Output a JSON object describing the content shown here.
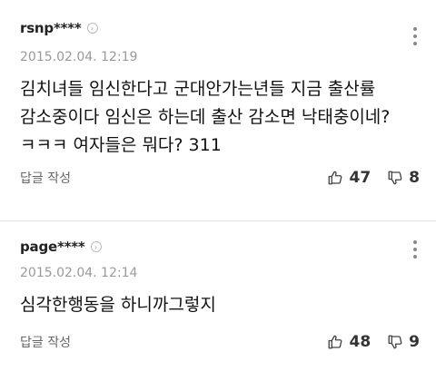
{
  "comments": [
    {
      "username": "rsnp****",
      "timestamp": "2015.02.04. 12:19",
      "text": "김치녀들 임신한다고 군대안가는년들 지금 출산률 감소중이다 임신은 하는데 출산 감소면 낙태충이네? ㅋㅋㅋ 여자들은 뭐다? 311",
      "reply_label": "답글 작성",
      "likes": "47",
      "dislikes": "8"
    },
    {
      "username": "page****",
      "timestamp": "2015.02.04. 12:14",
      "text": "심각한행동을 하니까그렇지",
      "reply_label": "답글 작성",
      "likes": "48",
      "dislikes": "9"
    }
  ],
  "icons": {
    "badge": "profile-badge-icon",
    "more": "more-vertical-icon",
    "like": "thumbs-up-icon",
    "dislike": "thumbs-down-icon"
  },
  "colors": {
    "text": "#111111",
    "muted": "#9a9a9a",
    "divider": "#e6e6e6"
  }
}
